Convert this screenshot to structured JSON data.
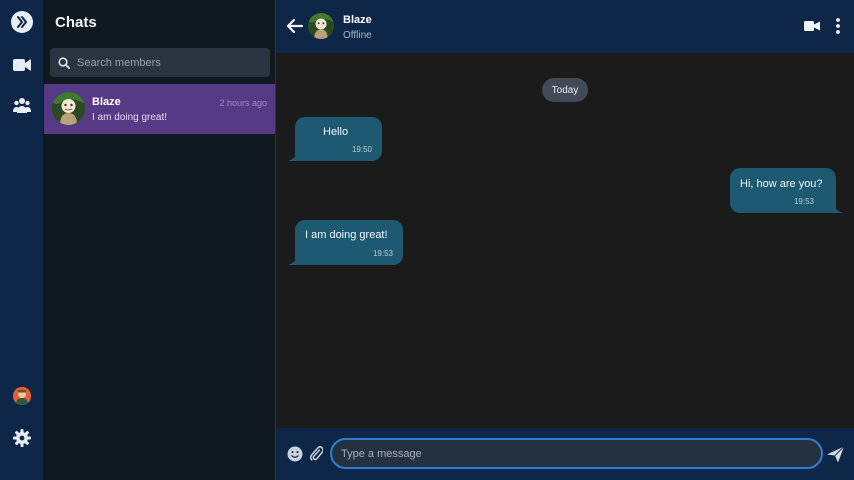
{
  "rail": {
    "icons": [
      "logo-icon",
      "video-icon",
      "people-icon",
      "user-avatar",
      "gear-icon"
    ]
  },
  "chatlist": {
    "title": "Chats",
    "search_placeholder": "Search members",
    "items": [
      {
        "name": "Blaze",
        "time": "2 hours ago",
        "preview": "I am doing great!"
      }
    ]
  },
  "conversation": {
    "contact_name": "Blaze",
    "status": "Offline",
    "day_label": "Today",
    "messages": [
      {
        "text": "Hello",
        "time": "19:50",
        "direction": "incoming"
      },
      {
        "text": "Hi, how are you?",
        "time": "19:53",
        "direction": "outgoing"
      },
      {
        "text": "I am doing great!",
        "time": "19:53",
        "direction": "incoming"
      }
    ],
    "input_placeholder": "Type a message"
  },
  "colors": {
    "rail_bg": "#0e2748",
    "list_bg": "#101820",
    "selected_chat": "#563a86",
    "bubble": "#1d5a72",
    "input_border": "#2f7fd0"
  }
}
